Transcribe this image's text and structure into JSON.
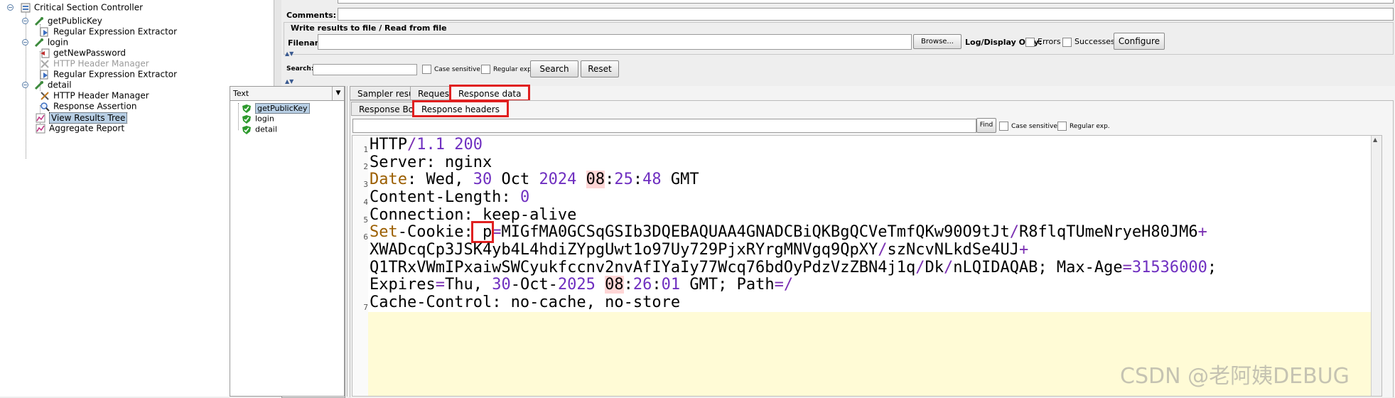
{
  "tree": {
    "items": [
      {
        "label": "Critical Section Controller",
        "icon": "controller-icon"
      },
      {
        "label": "getPublicKey",
        "icon": "sampler-icon"
      },
      {
        "label": "Regular Expression Extractor",
        "icon": "post-processor-icon"
      },
      {
        "label": "login",
        "icon": "sampler-icon"
      },
      {
        "label": "getNewPassword",
        "icon": "pre-processor-icon"
      },
      {
        "label": "HTTP Header Manager",
        "icon": "config-icon"
      },
      {
        "label": "Regular Expression Extractor",
        "icon": "post-processor-icon"
      },
      {
        "label": "detail",
        "icon": "sampler-icon"
      },
      {
        "label": "HTTP Header Manager",
        "icon": "config-icon"
      },
      {
        "label": "Response Assertion",
        "icon": "assertion-icon"
      },
      {
        "label": "View Results Tree",
        "icon": "listener-icon"
      },
      {
        "label": "Aggregate Report",
        "icon": "listener-icon"
      }
    ]
  },
  "comments": {
    "label": "Comments:",
    "value": ""
  },
  "file_section": {
    "title": "Write results to file / Read from file",
    "filename_label": "Filename",
    "filename_value": "",
    "browse_label": "Browse...",
    "log_display_label": "Log/Display Only:",
    "errors_label": "Errors",
    "successes_label": "Successes",
    "configure_label": "Configure"
  },
  "search": {
    "label": "Search:",
    "value": "",
    "case_sensitive_label": "Case sensitive",
    "regular_exp_label": "Regular exp.",
    "search_button": "Search",
    "reset_button": "Reset"
  },
  "renderer": {
    "selected": "Text"
  },
  "results": [
    {
      "label": "getPublicKey"
    },
    {
      "label": "login"
    },
    {
      "label": "detail"
    }
  ],
  "tabs": {
    "sampler_result": "Sampler result",
    "request": "Request",
    "response_data": "Response data"
  },
  "subtabs": {
    "response_body": "Response Body",
    "response_headers": "Response headers"
  },
  "find_bar": {
    "value": "",
    "find_button": "Find",
    "case_sensitive_label": "Case sensitive",
    "regular_exp_label": "Regular exp."
  },
  "headers": {
    "line_numbers": [
      "1",
      "2",
      "3",
      "4",
      "5",
      "6",
      "7"
    ],
    "l1": {
      "a": "HTTP",
      "b": "/",
      "c": "1.1",
      "d": " ",
      "e": "200"
    },
    "l2": {
      "a": "Server",
      "b": ": nginx"
    },
    "l3": {
      "a": "Date",
      "b": ": Wed, ",
      "c": "30",
      "d": " Oct ",
      "e": "2024",
      "f": " ",
      "g": "08",
      "h": ":",
      "i": "25",
      "j": ":",
      "k": "48",
      "l": " GMT"
    },
    "l4": {
      "a": "Content-Length",
      "b": ": ",
      "c": "0"
    },
    "l5": {
      "a": "Connection",
      "b": ": keep-alive"
    },
    "l6": {
      "a": "Set",
      "b": "-Cookie",
      "c": ":",
      "d": " p",
      "e": "=",
      "f": "MIGfMA0GCSqGSIb3DQEBAQUAA4GNADCBiQKBgQCVeTmfQKw90O9tJt",
      "g": "/",
      "h": "R8flqTUmeNryeH80JM6",
      "i": "+"
    },
    "l6b": {
      "a": "XWADcqCp3JSK4yb4L4hdiZYpgUwt1o97Uy729PjxRYrgMNVgq9QpXY",
      "b": "/",
      "c": "szNcvNLkdSe4UJ",
      "d": "+"
    },
    "l6c": {
      "a": "Q1TRxVWmIPxaiwSWCyukfccnv2nvAfIYaIy77Wcq76bdOyPdzVzZBN4j1q",
      "b": "/",
      "c": "Dk",
      "d": "/",
      "e": "nLQIDAQAB; Max-Age",
      "f": "=",
      "g": "31536000",
      "h": ";"
    },
    "l6d": {
      "a": "Expires",
      "b": "=",
      "c": "Thu, ",
      "d": "30",
      "e": "-Oct-",
      "f": "2025",
      "g": " ",
      "h": "08",
      "i": ":",
      "j": "26",
      "k": ":",
      "l": "01",
      "m": " GMT; Path",
      "n": "=",
      "o": "/"
    },
    "l7": {
      "a": "Cache-Control",
      "b": ": no-cache, no-store"
    }
  },
  "watermark": "CSDN @老阿姨DEBUG",
  "colors": {
    "highlight_border": "#e02020",
    "number": "#6f2fc0",
    "header_name": "#9b5e00",
    "selection": "#b8cfe5"
  }
}
